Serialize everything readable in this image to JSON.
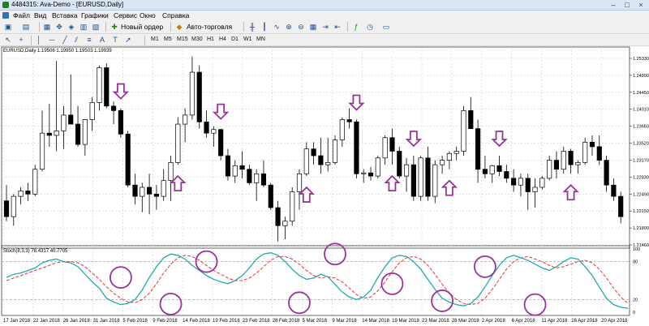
{
  "window": {
    "title": "4484315: Ava-Demo - [EURUSD,Daily]",
    "minimize": "–",
    "maximize": "□",
    "close": "×"
  },
  "menu": [
    "Файл",
    "Вид",
    "Вставка",
    "Графики",
    "Сервис",
    "Окно",
    "Справка"
  ],
  "toolbar": {
    "new_order": "Новый ордер",
    "auto_trading": "Авто-торговля",
    "new_order_icon": "plus-icon",
    "auto_trading_icon": "robot-icon"
  },
  "timeframes": [
    "M1",
    "M5",
    "M15",
    "M30",
    "H1",
    "H4",
    "D1",
    "W1",
    "MN"
  ],
  "chart_header": "EURUSD,Daily  1.19506 1.19950 1.19503 1.19939",
  "stoch_header": "Stoch(8,3,3) 78.4317 40.7705",
  "colors": {
    "bull": "#ffffff",
    "bear": "#000000",
    "arrow": "#993399",
    "circle": "#993399",
    "k_line": "#22aaaa",
    "d_line": "#ee3333",
    "grid": "#c8c8c8"
  },
  "chart_data": {
    "type": "candlestick",
    "price_axis": [
      "1.25330",
      "1.24890",
      "1.24450",
      "1.24010",
      "1.23660",
      "1.23520",
      "1.23170",
      "1.22830",
      "1.22490",
      "1.22150",
      "1.21800",
      "1.21460"
    ],
    "stoch_axis": [
      "100",
      "80",
      "20",
      "0"
    ],
    "x_labels": [
      "17 Jan 2018",
      "22 Jan 2018",
      "26 Jan 2018",
      "31 Jan 2018",
      "5 Feb 2018",
      "9 Feb 2018",
      "14 Feb 2018",
      "19 Feb 2018",
      "23 Feb 2018",
      "28 Feb 2018",
      "5 Mar 2018",
      "9 Mar 2018",
      "14 Mar 2018",
      "19 Mar 2018",
      "23 Mar 2018",
      "28 Mar 2018",
      "2 Apr 2018",
      "6 Apr 2018",
      "11 Apr 2018",
      "16 Apr 2018",
      "20 Apr 2018"
    ],
    "ohlc": [
      [
        1.224,
        1.2275,
        1.2195,
        1.2205
      ],
      [
        1.2205,
        1.2255,
        1.2185,
        1.225
      ],
      [
        1.225,
        1.227,
        1.2232,
        1.2262
      ],
      [
        1.2262,
        1.228,
        1.224,
        1.2255
      ],
      [
        1.2255,
        1.232,
        1.225,
        1.231
      ],
      [
        1.231,
        1.244,
        1.2305,
        1.239
      ],
      [
        1.239,
        1.2455,
        1.236,
        1.2385
      ],
      [
        1.2385,
        1.255,
        1.235,
        1.2395
      ],
      [
        1.2395,
        1.245,
        1.2355,
        1.243
      ],
      [
        1.243,
        1.252,
        1.242,
        1.241
      ],
      [
        1.241,
        1.245,
        1.236,
        1.2365
      ],
      [
        1.2365,
        1.242,
        1.234,
        1.242
      ],
      [
        1.242,
        1.247,
        1.2395,
        1.2458
      ],
      [
        1.2458,
        1.254,
        1.244,
        1.2535
      ],
      [
        1.2535,
        1.2545,
        1.2445,
        1.245
      ],
      [
        1.245,
        1.246,
        1.241,
        1.244
      ],
      [
        1.244,
        1.2445,
        1.238,
        1.2388
      ],
      [
        1.2388,
        1.2395,
        1.227,
        1.2275
      ],
      [
        1.2275,
        1.23,
        1.2232,
        1.225
      ],
      [
        1.225,
        1.228,
        1.2215,
        1.227
      ],
      [
        1.227,
        1.23,
        1.221,
        1.2255
      ],
      [
        1.2255,
        1.2275,
        1.222,
        1.225
      ],
      [
        1.225,
        1.231,
        1.224,
        1.2285
      ],
      [
        1.2285,
        1.234,
        1.224,
        1.2325
      ],
      [
        1.2325,
        1.2425,
        1.232,
        1.241
      ],
      [
        1.241,
        1.2445,
        1.237,
        1.243
      ],
      [
        1.243,
        1.256,
        1.242,
        1.2525
      ],
      [
        1.2525,
        1.254,
        1.24,
        1.2415
      ],
      [
        1.2415,
        1.244,
        1.238,
        1.239
      ],
      [
        1.239,
        1.2405,
        1.236,
        1.2398
      ],
      [
        1.2398,
        1.24,
        1.233,
        1.234
      ],
      [
        1.234,
        1.2355,
        1.2285,
        1.2295
      ],
      [
        1.2295,
        1.233,
        1.228,
        1.2318
      ],
      [
        1.2318,
        1.235,
        1.229,
        1.231
      ],
      [
        1.231,
        1.232,
        1.2275,
        1.228
      ],
      [
        1.228,
        1.231,
        1.224,
        1.23
      ],
      [
        1.23,
        1.233,
        1.227,
        1.2275
      ],
      [
        1.2275,
        1.228,
        1.222,
        1.2225
      ],
      [
        1.2225,
        1.224,
        1.215,
        1.2185
      ],
      [
        1.2185,
        1.2205,
        1.2155,
        1.2195
      ],
      [
        1.2195,
        1.227,
        1.2185,
        1.226
      ],
      [
        1.226,
        1.231,
        1.222,
        1.23
      ],
      [
        1.23,
        1.237,
        1.2295,
        1.2355
      ],
      [
        1.2355,
        1.237,
        1.232,
        1.234
      ],
      [
        1.234,
        1.238,
        1.23,
        1.232
      ],
      [
        1.232,
        1.238,
        1.2305,
        1.2325
      ],
      [
        1.2325,
        1.2385,
        1.232,
        1.2375
      ],
      [
        1.2375,
        1.2425,
        1.236,
        1.242
      ],
      [
        1.242,
        1.2445,
        1.24,
        1.2415
      ],
      [
        1.2415,
        1.242,
        1.229,
        1.23
      ],
      [
        1.23,
        1.231,
        1.228,
        1.2302
      ],
      [
        1.2302,
        1.2315,
        1.2285,
        1.2295
      ],
      [
        1.2295,
        1.234,
        1.229,
        1.2335
      ],
      [
        1.2335,
        1.2385,
        1.232,
        1.238
      ],
      [
        1.238,
        1.24,
        1.232,
        1.235
      ],
      [
        1.235,
        1.236,
        1.229,
        1.2295
      ],
      [
        1.2295,
        1.2335,
        1.226,
        1.232
      ],
      [
        1.232,
        1.234,
        1.224,
        1.225
      ],
      [
        1.225,
        1.234,
        1.224,
        1.2335
      ],
      [
        1.2335,
        1.236,
        1.224,
        1.225
      ],
      [
        1.225,
        1.233,
        1.2235,
        1.232
      ],
      [
        1.232,
        1.234,
        1.23,
        1.233
      ],
      [
        1.233,
        1.235,
        1.231,
        1.2345
      ],
      [
        1.2345,
        1.236,
        1.233,
        1.235
      ],
      [
        1.235,
        1.245,
        1.234,
        1.244
      ],
      [
        1.244,
        1.247,
        1.24,
        1.24
      ],
      [
        1.24,
        1.242,
        1.228,
        1.231
      ],
      [
        1.231,
        1.234,
        1.229,
        1.23
      ],
      [
        1.23,
        1.232,
        1.228,
        1.2318
      ],
      [
        1.2318,
        1.234,
        1.2295,
        1.2305
      ],
      [
        1.2305,
        1.232,
        1.228,
        1.229
      ],
      [
        1.229,
        1.231,
        1.226,
        1.2275
      ],
      [
        1.2275,
        1.23,
        1.225,
        1.229
      ],
      [
        1.229,
        1.23,
        1.222,
        1.226
      ],
      [
        1.226,
        1.229,
        1.2225,
        1.227
      ],
      [
        1.227,
        1.2295,
        1.2265,
        1.229
      ],
      [
        1.229,
        1.234,
        1.2285,
        1.233
      ],
      [
        1.233,
        1.235,
        1.229,
        1.231
      ],
      [
        1.231,
        1.236,
        1.23,
        1.235
      ],
      [
        1.235,
        1.2355,
        1.23,
        1.232
      ],
      [
        1.232,
        1.233,
        1.23,
        1.2325
      ],
      [
        1.2325,
        1.238,
        1.232,
        1.237
      ],
      [
        1.237,
        1.2385,
        1.234,
        1.236
      ],
      [
        1.236,
        1.2385,
        1.232,
        1.233
      ],
      [
        1.233,
        1.234,
        1.226,
        1.2275
      ],
      [
        1.2275,
        1.229,
        1.224,
        1.225
      ],
      [
        1.225,
        1.226,
        1.219,
        1.2205
      ]
    ],
    "stoch_k": [
      55,
      60,
      62,
      66,
      70,
      78,
      82,
      84,
      80,
      78,
      72,
      60,
      48,
      38,
      22,
      16,
      12,
      14,
      20,
      35,
      55,
      72,
      86,
      92,
      90,
      84,
      74,
      66,
      58,
      52,
      48,
      45,
      50,
      58,
      70,
      84,
      92,
      94,
      90,
      80,
      68,
      58,
      52,
      54,
      60,
      56,
      44,
      32,
      24,
      20,
      24,
      35,
      55,
      72,
      86,
      90,
      88,
      80,
      68,
      52,
      36,
      22,
      16,
      12,
      10,
      14,
      24,
      40,
      58,
      74,
      86,
      90,
      86,
      82,
      76,
      70,
      66,
      72,
      80,
      86,
      84,
      72,
      58,
      40,
      22,
      12,
      8,
      6
    ],
    "stoch_d": [
      50,
      54,
      58,
      62,
      66,
      70,
      74,
      78,
      80,
      80,
      78,
      72,
      62,
      52,
      40,
      30,
      22,
      16,
      15,
      20,
      30,
      45,
      62,
      76,
      86,
      90,
      88,
      82,
      74,
      66,
      60,
      54,
      50,
      50,
      54,
      62,
      72,
      82,
      88,
      88,
      84,
      76,
      66,
      58,
      54,
      56,
      54,
      48,
      38,
      28,
      22,
      24,
      34,
      48,
      64,
      78,
      86,
      88,
      84,
      74,
      60,
      44,
      30,
      20,
      14,
      12,
      14,
      22,
      36,
      52,
      68,
      80,
      86,
      88,
      84,
      80,
      74,
      70,
      72,
      76,
      80,
      82,
      78,
      68,
      54,
      38,
      24,
      14
    ]
  }
}
